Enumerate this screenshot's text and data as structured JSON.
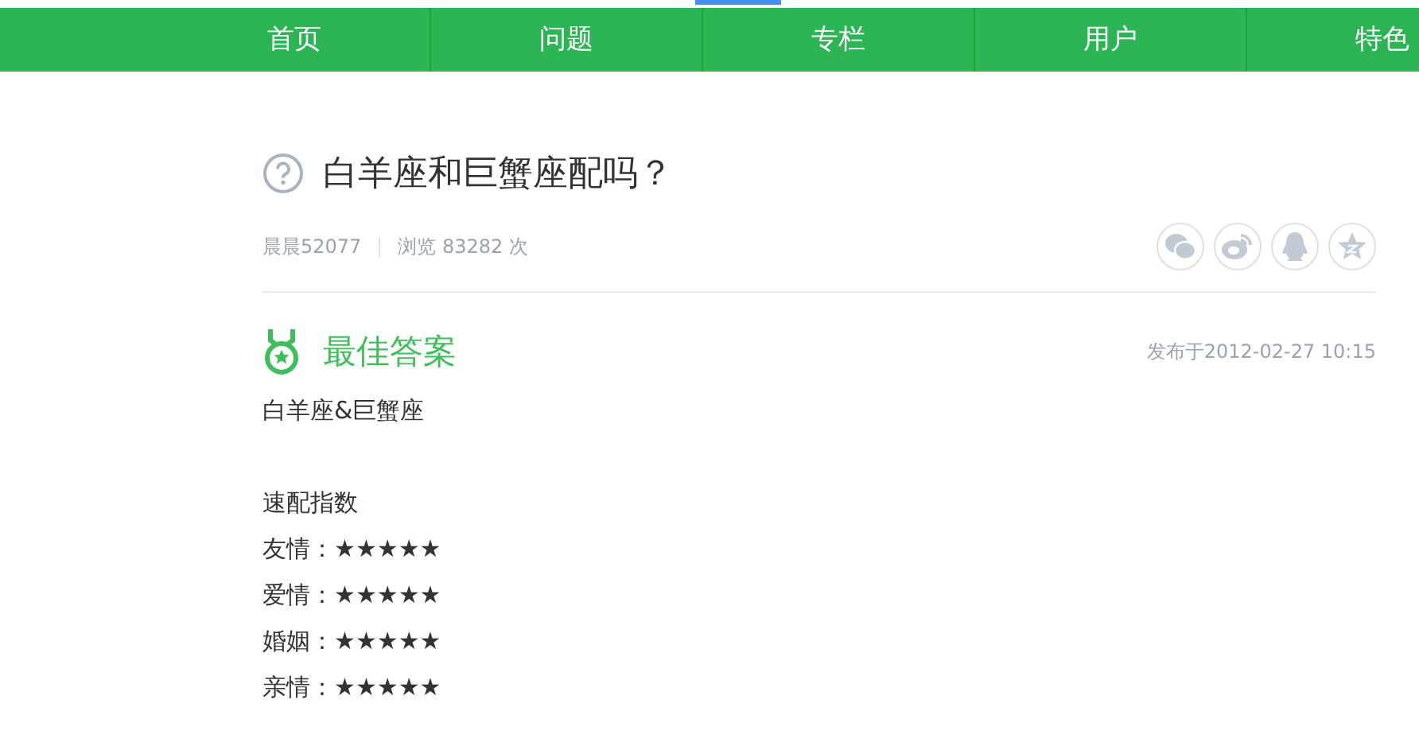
{
  "nav": {
    "items": [
      {
        "label": "首页",
        "selected": false
      },
      {
        "label": "问题",
        "selected": false
      },
      {
        "label": "专栏",
        "selected": false
      },
      {
        "label": "用户",
        "selected": false
      },
      {
        "label": "特色",
        "selected": false
      }
    ]
  },
  "question": {
    "title": "白羊座和巨蟹座配吗？",
    "author": "晨晨52077",
    "views": "浏览 83282 次"
  },
  "share": {
    "items": [
      {
        "kind": "chat"
      },
      {
        "kind": "weibo"
      },
      {
        "kind": "penguin"
      },
      {
        "kind": "star"
      }
    ]
  },
  "answer": {
    "heading": "最佳答案",
    "published": "发布于2012-02-27 10:15",
    "paragraphs": [
      {
        "lines": [
          "白羊座&巨蟹座"
        ]
      },
      {
        "lines": [
          "速配指数",
          "友情：★★★★★",
          "爱情：★★★★★",
          "婚姻：★★★★★",
          "亲情：★★★★★"
        ]
      }
    ]
  }
}
